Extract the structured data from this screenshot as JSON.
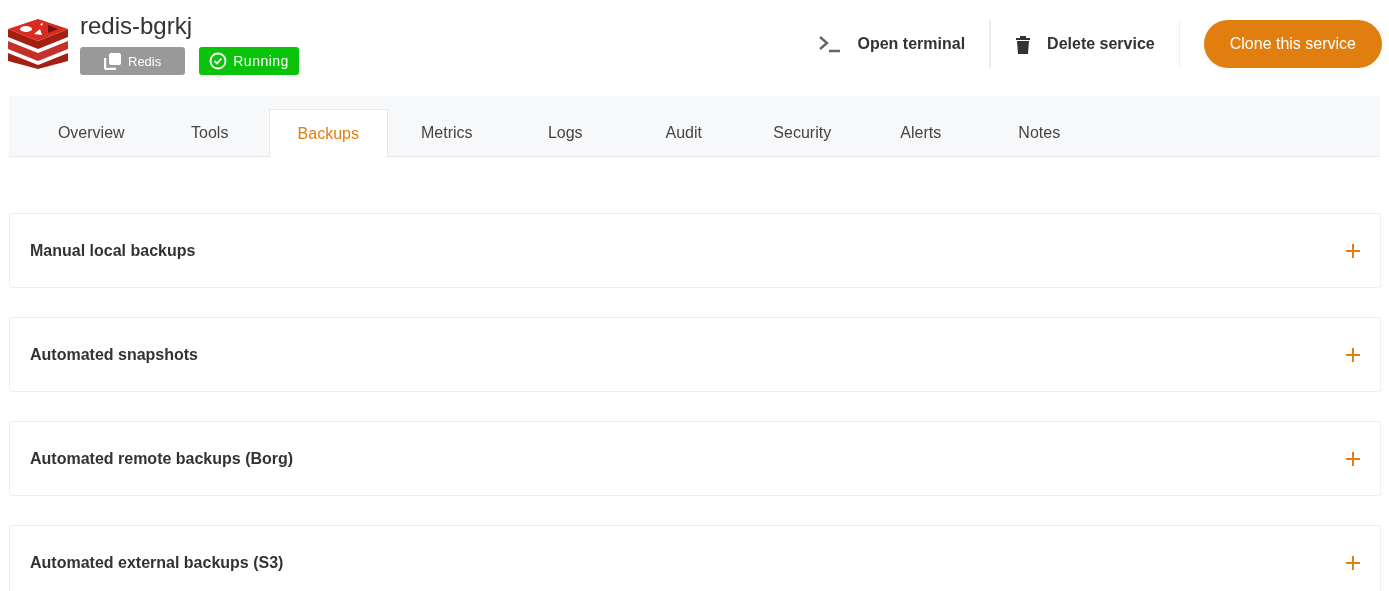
{
  "service": {
    "name": "redis-bgrkj",
    "type_badge": "Redis",
    "status": {
      "label": "Running",
      "kind": "running"
    }
  },
  "actions": [
    {
      "label": "Open terminal",
      "kind": "terminal"
    },
    {
      "label": "Delete service",
      "kind": "delete"
    },
    {
      "label": "Clone this service",
      "kind": "primary"
    }
  ],
  "tabs": [
    {
      "label": "Overview",
      "selected": false
    },
    {
      "label": "Tools",
      "selected": false
    },
    {
      "label": "Backups",
      "selected": true
    },
    {
      "label": "Metrics",
      "selected": false
    },
    {
      "label": "Logs",
      "selected": false
    },
    {
      "label": "Audit",
      "selected": false
    },
    {
      "label": "Security",
      "selected": false
    },
    {
      "label": "Alerts",
      "selected": false
    },
    {
      "label": "Notes",
      "selected": false
    }
  ],
  "sections": [
    {
      "title": "Manual local backups",
      "expanded": false
    },
    {
      "title": "Automated snapshots",
      "expanded": false
    },
    {
      "title": "Automated remote backups (Borg)",
      "expanded": false
    },
    {
      "title": "Automated external backups (S3)",
      "expanded": false
    }
  ]
}
